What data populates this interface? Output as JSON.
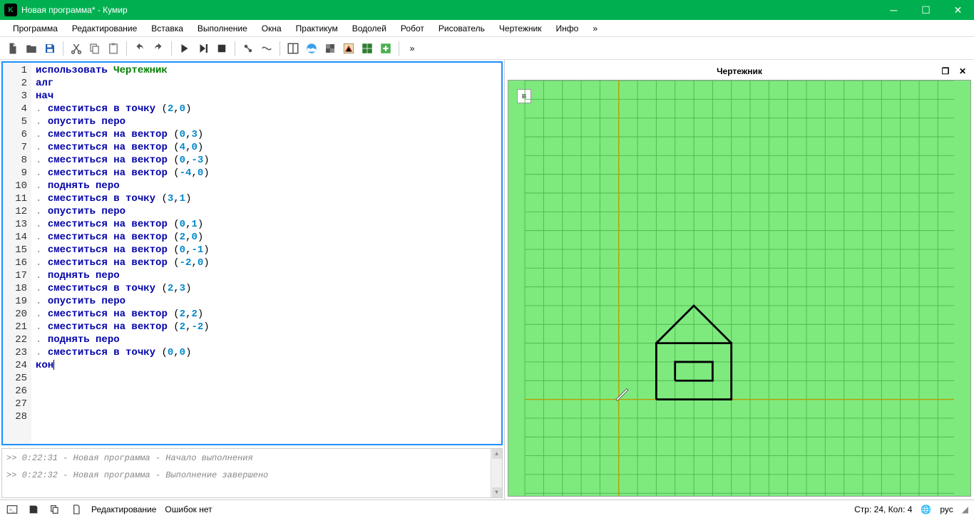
{
  "title": "Новая программа* - Кумир",
  "appIconLetter": "K",
  "menu": [
    "Программа",
    "Редактирование",
    "Вставка",
    "Выполнение",
    "Окна",
    "Практикум",
    "Водолей",
    "Робот",
    "Рисователь",
    "Чертежник",
    "Инфо",
    "»"
  ],
  "canvasTitle": "Чертежник",
  "code": {
    "lines": [
      {
        "n": 1,
        "tokens": [
          {
            "t": "использовать ",
            "c": "kw"
          },
          {
            "t": "Чертежник",
            "c": "str"
          }
        ]
      },
      {
        "n": 2,
        "tokens": [
          {
            "t": "алг",
            "c": "kw"
          }
        ]
      },
      {
        "n": 3,
        "tokens": [
          {
            "t": "нач",
            "c": "kw"
          }
        ]
      },
      {
        "n": 4,
        "tokens": [
          {
            "t": ". ",
            "c": "dot"
          },
          {
            "t": "сместиться в точку ",
            "c": "kw"
          },
          {
            "t": "(",
            "c": "op"
          },
          {
            "t": "2",
            "c": "num"
          },
          {
            "t": ",",
            "c": "op"
          },
          {
            "t": "0",
            "c": "num"
          },
          {
            "t": ")",
            "c": "op"
          }
        ]
      },
      {
        "n": 5,
        "tokens": [
          {
            "t": ". ",
            "c": "dot"
          },
          {
            "t": "опустить перо",
            "c": "kw"
          }
        ]
      },
      {
        "n": 6,
        "tokens": [
          {
            "t": ". ",
            "c": "dot"
          },
          {
            "t": "сместиться на вектор ",
            "c": "kw"
          },
          {
            "t": "(",
            "c": "op"
          },
          {
            "t": "0",
            "c": "num"
          },
          {
            "t": ",",
            "c": "op"
          },
          {
            "t": "3",
            "c": "num"
          },
          {
            "t": ")",
            "c": "op"
          }
        ]
      },
      {
        "n": 7,
        "tokens": [
          {
            "t": ". ",
            "c": "dot"
          },
          {
            "t": "сместиться на вектор ",
            "c": "kw"
          },
          {
            "t": "(",
            "c": "op"
          },
          {
            "t": "4",
            "c": "num"
          },
          {
            "t": ",",
            "c": "op"
          },
          {
            "t": "0",
            "c": "num"
          },
          {
            "t": ")",
            "c": "op"
          }
        ]
      },
      {
        "n": 8,
        "tokens": [
          {
            "t": ". ",
            "c": "dot"
          },
          {
            "t": "сместиться на вектор ",
            "c": "kw"
          },
          {
            "t": "(",
            "c": "op"
          },
          {
            "t": "0",
            "c": "num"
          },
          {
            "t": ",",
            "c": "op"
          },
          {
            "t": "-3",
            "c": "num"
          },
          {
            "t": ")",
            "c": "op"
          }
        ]
      },
      {
        "n": 9,
        "tokens": [
          {
            "t": ". ",
            "c": "dot"
          },
          {
            "t": "сместиться на вектор ",
            "c": "kw"
          },
          {
            "t": "(",
            "c": "op"
          },
          {
            "t": "-4",
            "c": "num"
          },
          {
            "t": ",",
            "c": "op"
          },
          {
            "t": "0",
            "c": "num"
          },
          {
            "t": ")",
            "c": "op"
          }
        ]
      },
      {
        "n": 10,
        "tokens": [
          {
            "t": ". ",
            "c": "dot"
          },
          {
            "t": "поднять перо",
            "c": "kw"
          }
        ]
      },
      {
        "n": 11,
        "tokens": [
          {
            "t": ". ",
            "c": "dot"
          },
          {
            "t": "сместиться в точку ",
            "c": "kw"
          },
          {
            "t": "(",
            "c": "op"
          },
          {
            "t": "3",
            "c": "num"
          },
          {
            "t": ",",
            "c": "op"
          },
          {
            "t": "1",
            "c": "num"
          },
          {
            "t": ")",
            "c": "op"
          }
        ]
      },
      {
        "n": 12,
        "tokens": [
          {
            "t": ". ",
            "c": "dot"
          },
          {
            "t": "опустить перо",
            "c": "kw"
          }
        ]
      },
      {
        "n": 13,
        "tokens": [
          {
            "t": ". ",
            "c": "dot"
          },
          {
            "t": "сместиться на вектор ",
            "c": "kw"
          },
          {
            "t": "(",
            "c": "op"
          },
          {
            "t": "0",
            "c": "num"
          },
          {
            "t": ",",
            "c": "op"
          },
          {
            "t": "1",
            "c": "num"
          },
          {
            "t": ")",
            "c": "op"
          }
        ]
      },
      {
        "n": 14,
        "tokens": [
          {
            "t": ". ",
            "c": "dot"
          },
          {
            "t": "сместиться на вектор ",
            "c": "kw"
          },
          {
            "t": "(",
            "c": "op"
          },
          {
            "t": "2",
            "c": "num"
          },
          {
            "t": ",",
            "c": "op"
          },
          {
            "t": "0",
            "c": "num"
          },
          {
            "t": ")",
            "c": "op"
          }
        ]
      },
      {
        "n": 15,
        "tokens": [
          {
            "t": ". ",
            "c": "dot"
          },
          {
            "t": "сместиться на вектор ",
            "c": "kw"
          },
          {
            "t": "(",
            "c": "op"
          },
          {
            "t": "0",
            "c": "num"
          },
          {
            "t": ",",
            "c": "op"
          },
          {
            "t": "-1",
            "c": "num"
          },
          {
            "t": ")",
            "c": "op"
          }
        ]
      },
      {
        "n": 16,
        "tokens": [
          {
            "t": ". ",
            "c": "dot"
          },
          {
            "t": "сместиться на вектор ",
            "c": "kw"
          },
          {
            "t": "(",
            "c": "op"
          },
          {
            "t": "-2",
            "c": "num"
          },
          {
            "t": ",",
            "c": "op"
          },
          {
            "t": "0",
            "c": "num"
          },
          {
            "t": ")",
            "c": "op"
          }
        ]
      },
      {
        "n": 17,
        "tokens": [
          {
            "t": ". ",
            "c": "dot"
          },
          {
            "t": "поднять перо",
            "c": "kw"
          }
        ]
      },
      {
        "n": 18,
        "tokens": [
          {
            "t": ". ",
            "c": "dot"
          },
          {
            "t": "сместиться в точку ",
            "c": "kw"
          },
          {
            "t": "(",
            "c": "op"
          },
          {
            "t": "2",
            "c": "num"
          },
          {
            "t": ",",
            "c": "op"
          },
          {
            "t": "3",
            "c": "num"
          },
          {
            "t": ")",
            "c": "op"
          }
        ]
      },
      {
        "n": 19,
        "tokens": [
          {
            "t": ". ",
            "c": "dot"
          },
          {
            "t": "опустить перо",
            "c": "kw"
          }
        ]
      },
      {
        "n": 20,
        "tokens": [
          {
            "t": ". ",
            "c": "dot"
          },
          {
            "t": "сместиться на вектор ",
            "c": "kw"
          },
          {
            "t": "(",
            "c": "op"
          },
          {
            "t": "2",
            "c": "num"
          },
          {
            "t": ",",
            "c": "op"
          },
          {
            "t": "2",
            "c": "num"
          },
          {
            "t": ")",
            "c": "op"
          }
        ]
      },
      {
        "n": 21,
        "tokens": [
          {
            "t": ". ",
            "c": "dot"
          },
          {
            "t": "сместиться на вектор ",
            "c": "kw"
          },
          {
            "t": "(",
            "c": "op"
          },
          {
            "t": "2",
            "c": "num"
          },
          {
            "t": ",",
            "c": "op"
          },
          {
            "t": "-2",
            "c": "num"
          },
          {
            "t": ")",
            "c": "op"
          }
        ]
      },
      {
        "n": 22,
        "tokens": [
          {
            "t": ". ",
            "c": "dot"
          },
          {
            "t": "поднять перо",
            "c": "kw"
          }
        ]
      },
      {
        "n": 23,
        "tokens": [
          {
            "t": ". ",
            "c": "dot"
          },
          {
            "t": "сместиться в точку ",
            "c": "kw"
          },
          {
            "t": "(",
            "c": "op"
          },
          {
            "t": "0",
            "c": "num"
          },
          {
            "t": ",",
            "c": "op"
          },
          {
            "t": "0",
            "c": "num"
          },
          {
            "t": ")",
            "c": "op"
          }
        ]
      },
      {
        "n": 24,
        "tokens": [
          {
            "t": "кон",
            "c": "kw"
          }
        ],
        "cursor": true
      },
      {
        "n": 25,
        "tokens": []
      },
      {
        "n": 26,
        "tokens": []
      },
      {
        "n": 27,
        "tokens": []
      },
      {
        "n": 28,
        "tokens": []
      }
    ]
  },
  "console": [
    ">>  0:22:31 - Новая программа - Начало выполнения",
    ">>  0:22:32 - Новая программа - Выполнение завершено"
  ],
  "status": {
    "edit": "Редактирование",
    "errors": "Ошибок нет",
    "pos": "Стр: 24, Кол: 4",
    "lang": "рус"
  },
  "canvas": {
    "grid": 28,
    "originX": 5,
    "originY": 17,
    "strokes": [
      [
        [
          2,
          0
        ],
        [
          2,
          3
        ],
        [
          6,
          3
        ],
        [
          6,
          0
        ],
        [
          2,
          0
        ]
      ],
      [
        [
          3,
          1
        ],
        [
          3,
          2
        ],
        [
          5,
          2
        ],
        [
          5,
          1
        ],
        [
          3,
          1
        ]
      ],
      [
        [
          2,
          3
        ],
        [
          4,
          5
        ],
        [
          6,
          3
        ]
      ]
    ],
    "pen": [
      0,
      0
    ]
  }
}
